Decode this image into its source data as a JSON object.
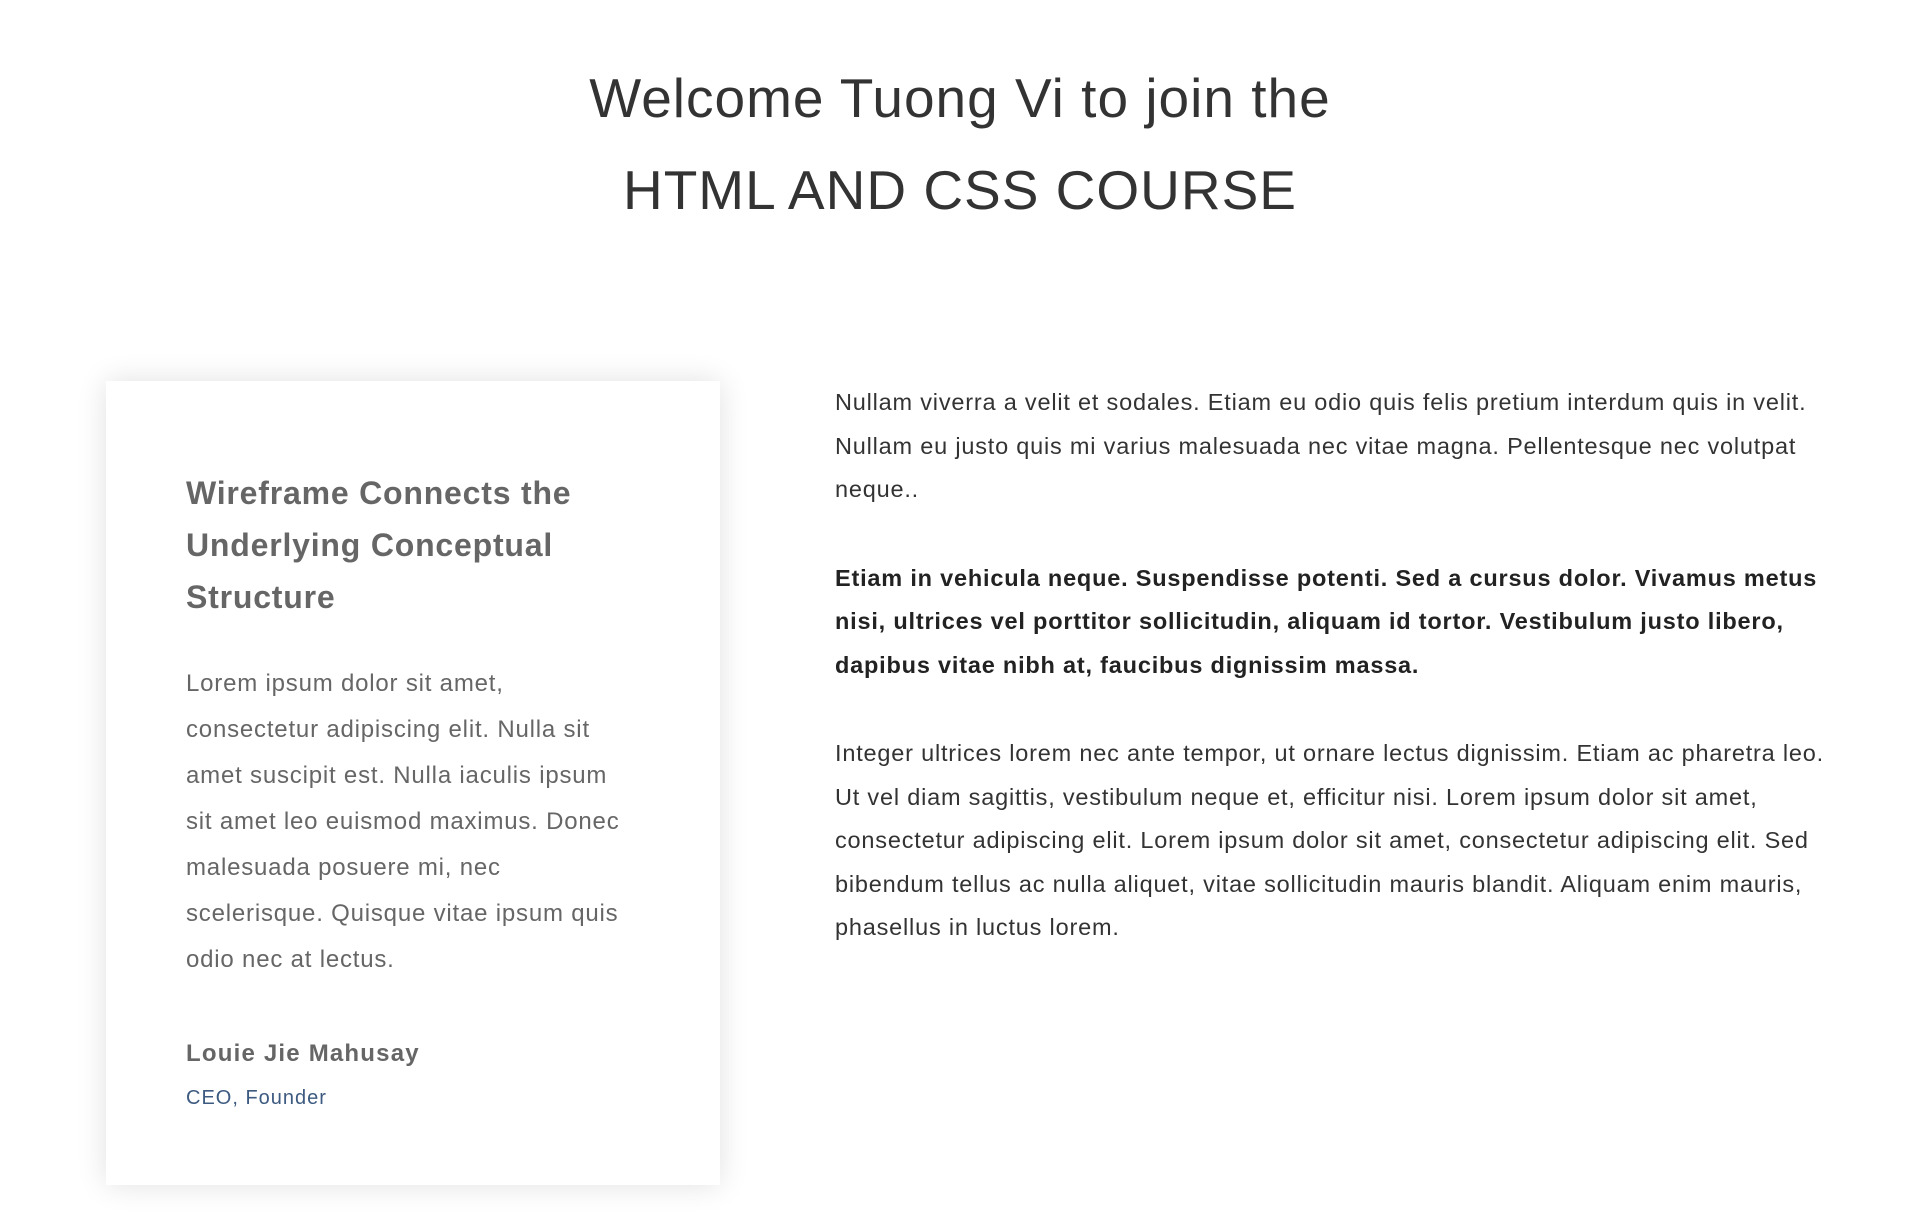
{
  "hero": {
    "line1": "Welcome Tuong Vi to join the",
    "line2": "HTML AND CSS COURSE"
  },
  "card": {
    "title": "Wireframe Connects the Underlying Conceptual Structure",
    "body": "Lorem ipsum dolor sit amet, consectetur adipiscing elit. Nulla sit amet suscipit est. Nulla iaculis ipsum sit amet leo euismod maximus. Donec malesuada posuere mi, nec scelerisque. Quisque vitae ipsum quis odio nec at lectus.",
    "author": "Louie Jie Mahusay",
    "role": "CEO, Founder"
  },
  "content": {
    "paragraph1": "Nullam viverra a velit et sodales. Etiam eu odio quis felis pretium interdum quis in velit. Nullam eu justo quis mi varius malesuada nec vitae magna. Pellentesque nec volutpat neque..",
    "paragraph2": "Etiam in vehicula neque. Suspendisse potenti. Sed a cursus dolor. Vivamus metus nisi, ultrices vel porttitor sollicitudin, aliquam id tortor. Vestibulum justo libero, dapibus vitae nibh at, faucibus dignissim massa.",
    "paragraph3": "Integer ultrices lorem nec ante tempor, ut ornare lectus dignissim. Etiam ac pharetra leo. Ut vel diam sagittis, vestibulum neque et, efficitur nisi. Lorem ipsum dolor sit amet, consectetur adipiscing elit. Lorem ipsum dolor sit amet, consectetur adipiscing elit. Sed bibendum tellus ac nulla aliquet, vitae sollicitudin mauris blandit. Aliquam enim mauris, phasellus in luctus lorem."
  },
  "colors": {
    "heading": "#333333",
    "card_text": "#666666",
    "role_text": "#3d5a80",
    "background": "#ffffff"
  }
}
